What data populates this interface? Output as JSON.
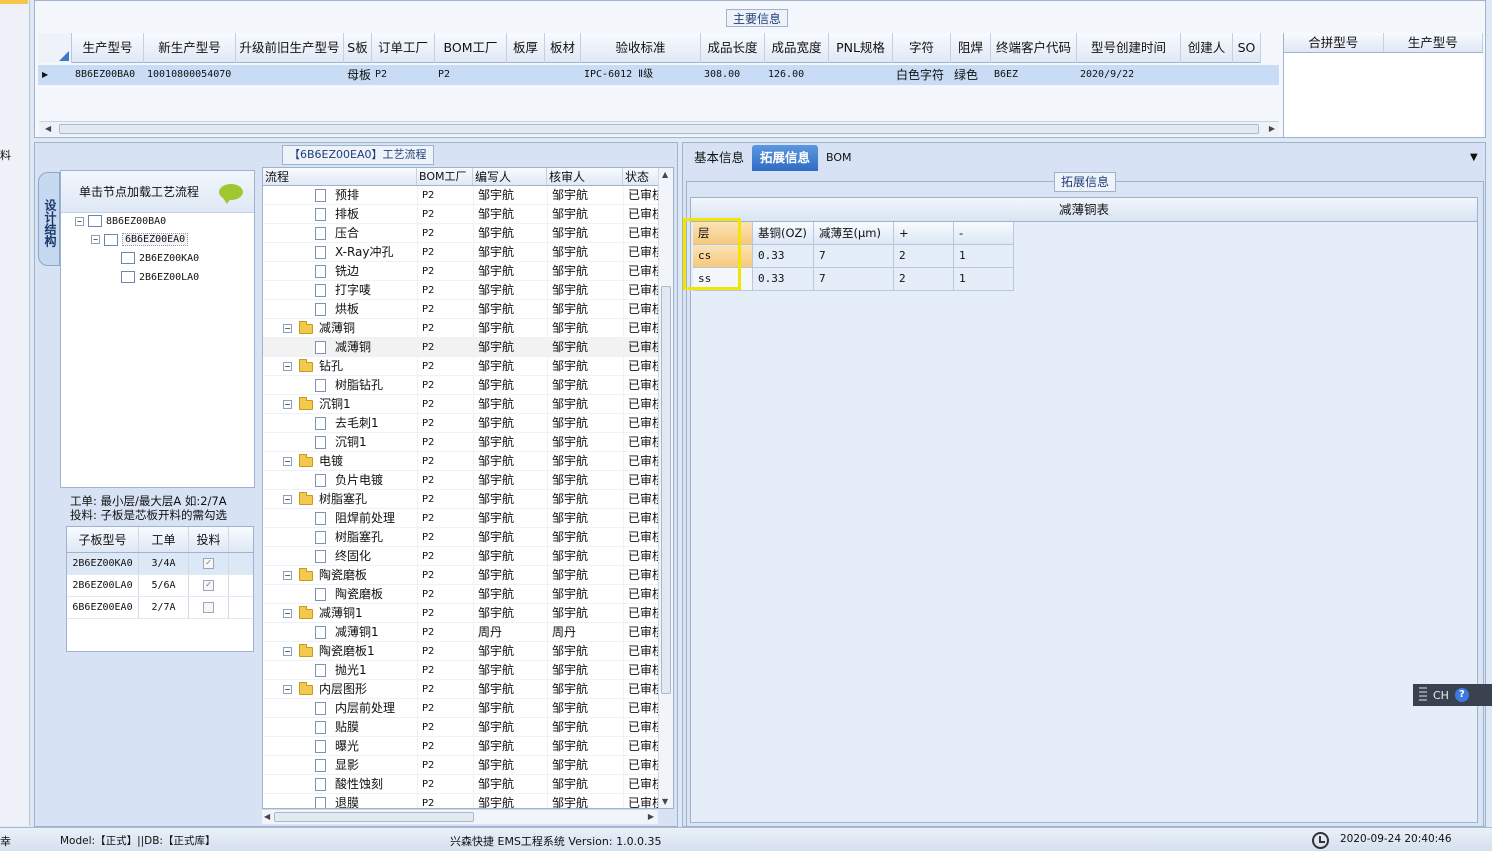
{
  "top": {
    "caption": "主要信息",
    "columns": [
      "生产型号",
      "新生产型号",
      "升级前旧生产型号",
      "S板",
      "订单工厂",
      "BOM工厂",
      "板厚",
      "板材",
      "验收标准",
      "成品长度",
      "成品宽度",
      "PNL规格",
      "字符",
      "阻焊",
      "终端客户代码",
      "型号创建时间",
      "创建人",
      "SO"
    ],
    "row": [
      "8B6EZ00BA0",
      "10010800054070",
      "",
      "母板",
      "P2",
      "P2",
      "",
      "",
      "IPC-6012 Ⅱ级",
      "308.00",
      "126.00",
      "",
      "白色字符",
      "绿色",
      "B6EZ",
      "2020/9/22",
      "",
      ""
    ],
    "right_columns": [
      "合拼型号",
      "生产型号"
    ]
  },
  "flow": {
    "caption": "【6B6EZ00EA0】工艺流程",
    "side_tab": "设计结构",
    "tree_header": "单击节点加载工艺流程",
    "tree_nodes": [
      "8B6EZ00BA0",
      "6B6EZ00EA0",
      "2B6EZ00KA0",
      "2B6EZ00LA0"
    ],
    "info_line1": "工单: 最小层/最大层A 如:2/7A",
    "info_line2": "投料: 子板是芯板开料的需勾选",
    "sub_columns": [
      "子板型号",
      "工单",
      "投料"
    ],
    "sub_rows": [
      {
        "model": "2B6EZ00KA0",
        "order": "3/4A",
        "feed": "✓"
      },
      {
        "model": "2B6EZ00LA0",
        "order": "5/6A",
        "feed": "✓"
      },
      {
        "model": "6B6EZ00EA0",
        "order": "2/7A",
        "feed": ""
      }
    ],
    "grid_columns": [
      "流程",
      "BOM工厂",
      "编写人",
      "核审人",
      "状态"
    ],
    "rows": [
      {
        "name": "预排",
        "factory": "P2",
        "writer": "邹宇航",
        "reviewer": "邹宇航",
        "status": "已审核"
      },
      {
        "name": "排板",
        "factory": "P2",
        "writer": "邹宇航",
        "reviewer": "邹宇航",
        "status": "已审核"
      },
      {
        "name": "压合",
        "factory": "P2",
        "writer": "邹宇航",
        "reviewer": "邹宇航",
        "status": "已审核"
      },
      {
        "name": "X-Ray冲孔",
        "factory": "P2",
        "writer": "邹宇航",
        "reviewer": "邹宇航",
        "status": "已审核"
      },
      {
        "name": "铣边",
        "factory": "P2",
        "writer": "邹宇航",
        "reviewer": "邹宇航",
        "status": "已审核"
      },
      {
        "name": "打字唛",
        "factory": "P2",
        "writer": "邹宇航",
        "reviewer": "邹宇航",
        "status": "已审核"
      },
      {
        "name": "烘板",
        "factory": "P2",
        "writer": "邹宇航",
        "reviewer": "邹宇航",
        "status": "已审核"
      },
      {
        "name": "减薄铜",
        "factory": "P2",
        "writer": "邹宇航",
        "reviewer": "邹宇航",
        "status": "已审核"
      },
      {
        "name": "减薄铜",
        "factory": "P2",
        "writer": "邹宇航",
        "reviewer": "邹宇航",
        "status": "已审核"
      },
      {
        "name": "钻孔",
        "factory": "P2",
        "writer": "邹宇航",
        "reviewer": "邹宇航",
        "status": "已审核"
      },
      {
        "name": "树脂钻孔",
        "factory": "P2",
        "writer": "邹宇航",
        "reviewer": "邹宇航",
        "status": "已审核"
      },
      {
        "name": "沉铜1",
        "factory": "P2",
        "writer": "邹宇航",
        "reviewer": "邹宇航",
        "status": "已审核"
      },
      {
        "name": "去毛刺1",
        "factory": "P2",
        "writer": "邹宇航",
        "reviewer": "邹宇航",
        "status": "已审核"
      },
      {
        "name": "沉铜1",
        "factory": "P2",
        "writer": "邹宇航",
        "reviewer": "邹宇航",
        "status": "已审核"
      },
      {
        "name": "电镀",
        "factory": "P2",
        "writer": "邹宇航",
        "reviewer": "邹宇航",
        "status": "已审核"
      },
      {
        "name": "负片电镀",
        "factory": "P2",
        "writer": "邹宇航",
        "reviewer": "邹宇航",
        "status": "已审核"
      },
      {
        "name": "树脂塞孔",
        "factory": "P2",
        "writer": "邹宇航",
        "reviewer": "邹宇航",
        "status": "已审核"
      },
      {
        "name": "阻焊前处理",
        "factory": "P2",
        "writer": "邹宇航",
        "reviewer": "邹宇航",
        "status": "已审核"
      },
      {
        "name": "树脂塞孔",
        "factory": "P2",
        "writer": "邹宇航",
        "reviewer": "邹宇航",
        "status": "已审核"
      },
      {
        "name": "终固化",
        "factory": "P2",
        "writer": "邹宇航",
        "reviewer": "邹宇航",
        "status": "已审核"
      },
      {
        "name": "陶瓷磨板",
        "factory": "P2",
        "writer": "邹宇航",
        "reviewer": "邹宇航",
        "status": "已审核"
      },
      {
        "name": "陶瓷磨板",
        "factory": "P2",
        "writer": "邹宇航",
        "reviewer": "邹宇航",
        "status": "已审核"
      },
      {
        "name": "减薄铜1",
        "factory": "P2",
        "writer": "邹宇航",
        "reviewer": "邹宇航",
        "status": "已审核"
      },
      {
        "name": "减薄铜1",
        "factory": "P2",
        "writer": "周丹",
        "reviewer": "周丹",
        "status": "已审核"
      },
      {
        "name": "陶瓷磨板1",
        "factory": "P2",
        "writer": "邹宇航",
        "reviewer": "邹宇航",
        "status": "已审核"
      },
      {
        "name": "抛光1",
        "factory": "P2",
        "writer": "邹宇航",
        "reviewer": "邹宇航",
        "status": "已审核"
      },
      {
        "name": "内层图形",
        "factory": "P2",
        "writer": "邹宇航",
        "reviewer": "邹宇航",
        "status": "已审核"
      },
      {
        "name": "内层前处理",
        "factory": "P2",
        "writer": "邹宇航",
        "reviewer": "邹宇航",
        "status": "已审核"
      },
      {
        "name": "贴膜",
        "factory": "P2",
        "writer": "邹宇航",
        "reviewer": "邹宇航",
        "status": "已审核"
      },
      {
        "name": "曝光",
        "factory": "P2",
        "writer": "邹宇航",
        "reviewer": "邹宇航",
        "status": "已审核"
      },
      {
        "name": "显影",
        "factory": "P2",
        "writer": "邹宇航",
        "reviewer": "邹宇航",
        "status": "已审核"
      },
      {
        "name": "酸性蚀刻",
        "factory": "P2",
        "writer": "邹宇航",
        "reviewer": "邹宇航",
        "status": "已审核"
      },
      {
        "name": "退膜",
        "factory": "P2",
        "writer": "邹宇航",
        "reviewer": "邹宇航",
        "status": "已审核"
      }
    ]
  },
  "right": {
    "tabs": [
      "基本信息",
      "拓展信息",
      "BOM"
    ],
    "caption": "拓展信息",
    "table_title": "减薄铜表",
    "columns": [
      "层",
      "基铜(OZ)",
      "减薄至(μm)",
      "+",
      "-"
    ],
    "rows": [
      [
        "cs",
        "0.33",
        "7",
        "2",
        "1"
      ],
      [
        "ss",
        "0.33",
        "7",
        "2",
        "1"
      ]
    ]
  },
  "ime": {
    "label": "CH",
    "help": "?"
  },
  "status": {
    "left": "幸",
    "model": "Model:【正式】||DB:【正式库】",
    "app": "兴森快捷 EMS工程系统 Version: 1.0.0.35",
    "datetime": "2020-09-24 20:40:46"
  },
  "left_strip": {
    "label": "料"
  }
}
